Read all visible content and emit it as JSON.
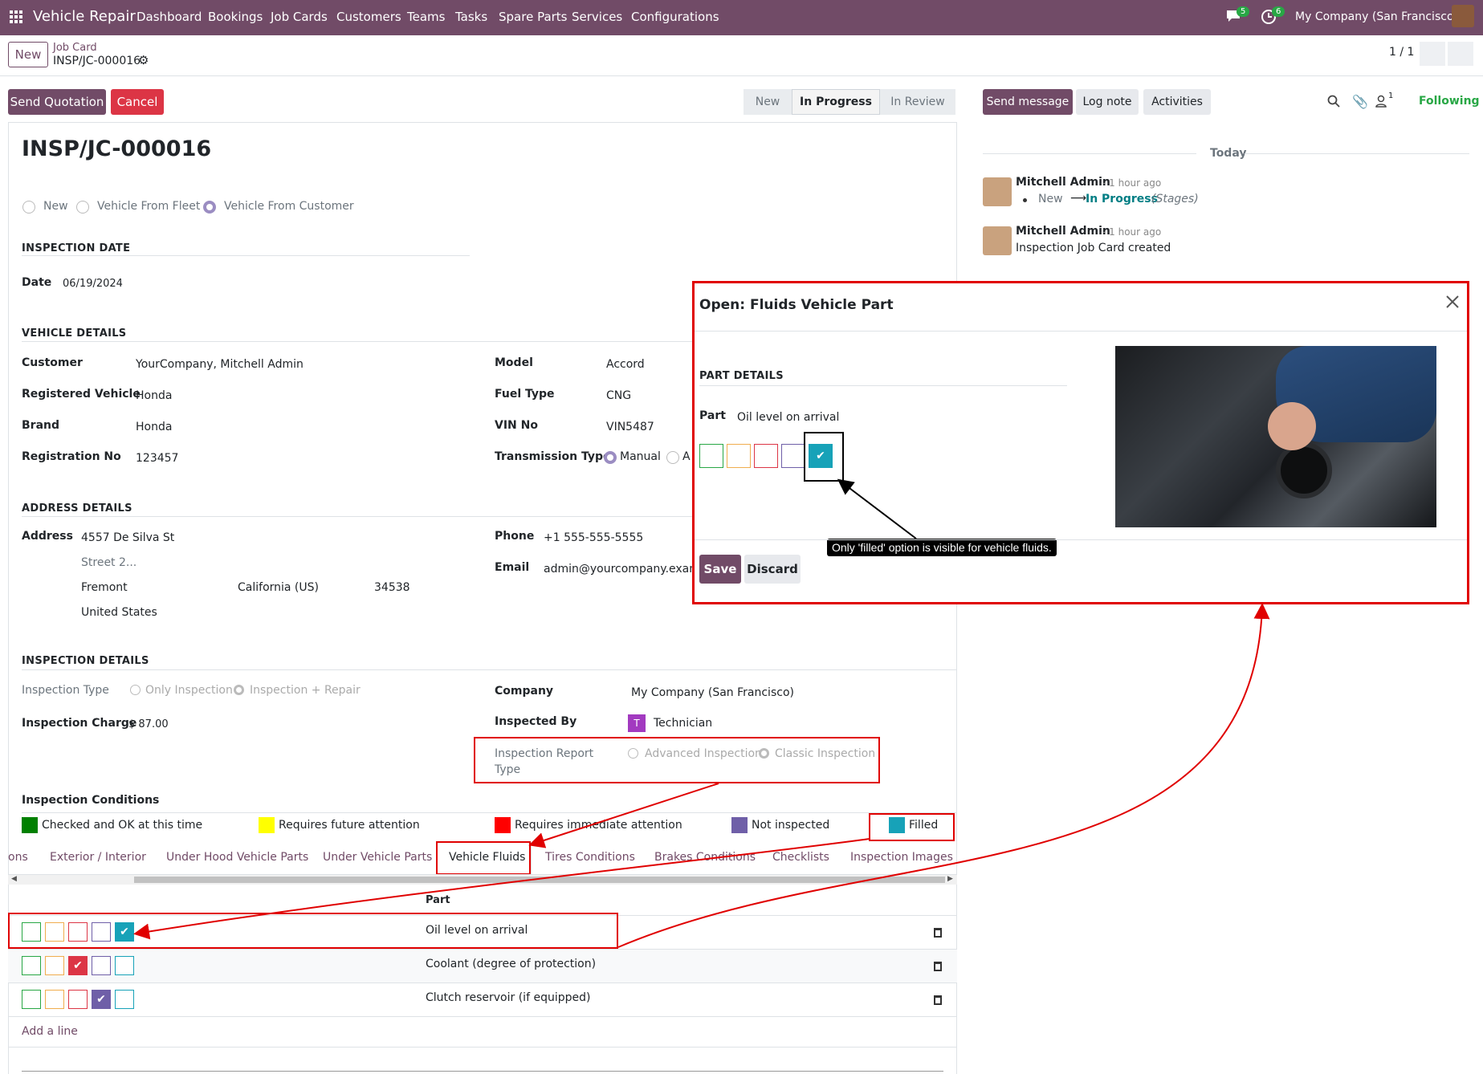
{
  "topbar": {
    "app": "Vehicle Repair",
    "menu": [
      "Dashboard",
      "Bookings",
      "Job Cards",
      "Customers",
      "Teams",
      "Tasks",
      "Spare Parts",
      "Services",
      "Configurations"
    ],
    "messages_count": "5",
    "activities_count": "6",
    "company": "My Company (San Francisco)"
  },
  "control": {
    "new_button": "New",
    "breadcrumb_parent": "Job Card",
    "breadcrumb_record": "INSP/JC-000016",
    "pager": "1 / 1"
  },
  "actions": {
    "send_quotation": "Send Quotation",
    "cancel": "Cancel",
    "stages": [
      "New",
      "In Progress",
      "In Review"
    ]
  },
  "chatter": {
    "send_message": "Send message",
    "log_note": "Log note",
    "activities": "Activities",
    "followers_count": "1",
    "following": "Following",
    "today": "Today",
    "messages": [
      {
        "author": "Mitchell Admin",
        "time": "- 1 hour ago",
        "stage_from": "New",
        "stage_to": "In Progress",
        "stage_field": "(Stages)"
      },
      {
        "author": "Mitchell Admin",
        "time": "- 1 hour ago",
        "body": "Inspection Job Card created"
      }
    ]
  },
  "form": {
    "title": "INSP/JC-000016",
    "vehicle_source": [
      "New",
      "Vehicle From Fleet",
      "Vehicle From Customer"
    ],
    "inspection_date_section": "INSPECTION DATE",
    "date_label": "Date",
    "date_value": "06/19/2024",
    "vehicle_details_section": "VEHICLE DETAILS",
    "customer_label": "Customer",
    "customer_value": "YourCompany, Mitchell Admin",
    "registered_vehicle_label": "Registered Vehicle",
    "registered_vehicle_value": "Honda",
    "brand_label": "Brand",
    "brand_value": "Honda",
    "registration_label": "Registration No",
    "registration_value": "123457",
    "model_label": "Model",
    "model_value": "Accord",
    "fuel_label": "Fuel Type",
    "fuel_value": "CNG",
    "vin_label": "VIN No",
    "vin_value": "VIN5487",
    "transmission_label": "Transmission Type",
    "transmission_manual": "Manual",
    "transmission_auto": "A",
    "address_section": "ADDRESS DETAILS",
    "address_label": "Address",
    "street": "4557 De Silva St",
    "street2": "Street 2...",
    "city": "Fremont",
    "state": "California (US)",
    "zip": "34538",
    "country": "United States",
    "phone_label": "Phone",
    "phone_value": "+1 555-555-5555",
    "email_label": "Email",
    "email_value": "admin@yourcompany.examp",
    "inspection_section": "INSPECTION DETAILS",
    "inspection_type_label": "Inspection Type",
    "inspection_type_opts": [
      "Only Inspection",
      "Inspection + Repair"
    ],
    "inspection_charge_label": "Inspection Charge",
    "inspection_charge_value": "$ 87.00",
    "company_label": "Company",
    "company_value": "My Company (San Francisco)",
    "inspected_by_label": "Inspected By",
    "inspected_by_avatar": "T",
    "inspected_by_value": "Technician",
    "report_type_label_1": "Inspection Report",
    "report_type_label_2": "Type",
    "report_type_opts": [
      "Advanced Inspection",
      "Classic Inspection"
    ],
    "conditions_title": "Inspection Conditions",
    "legend": [
      {
        "label": "Checked and OK at this time",
        "color": "#008000"
      },
      {
        "label": "Requires future attention",
        "color": "#ffff00"
      },
      {
        "label": "Requires immediate attention",
        "color": "#ff0000"
      },
      {
        "label": "Not inspected",
        "color": "#6f5fa8"
      },
      {
        "label": "Filled",
        "color": "#17a2b8"
      }
    ],
    "tabs": [
      "ons",
      "Exterior / Interior",
      "Under Hood Vehicle Parts",
      "Under Vehicle Parts",
      "Vehicle Fluids",
      "Tires Conditions",
      "Brakes Conditions",
      "Checklists",
      "Inspection Images"
    ],
    "table_header_part": "Part",
    "rows": [
      {
        "part": "Oil level on arrival",
        "checked": 4
      },
      {
        "part": "Coolant (degree of protection)",
        "checked": 2
      },
      {
        "part": "Clutch reservoir (if equipped)",
        "checked": 3
      }
    ],
    "add_line": "Add a line"
  },
  "colors": {
    "ok": "#28a745",
    "future": "#f0ad4e",
    "immediate": "#dc3545",
    "not_inspected": "#6f5fa8",
    "filled": "#17a2b8",
    "brand": "#714b67"
  },
  "dialog": {
    "title": "Open: Fluids Vehicle Part",
    "section": "PART DETAILS",
    "part_label": "Part",
    "part_value": "Oil level on arrival",
    "tooltip": "Only 'filled' option is visible for vehicle fluids.",
    "save": "Save",
    "discard": "Discard"
  }
}
